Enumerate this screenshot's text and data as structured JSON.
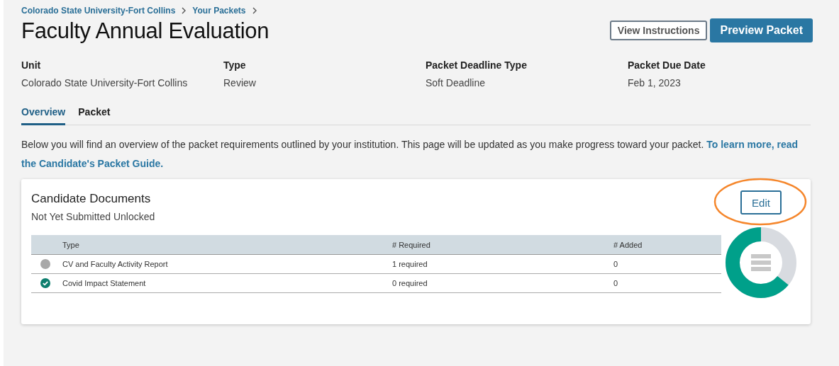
{
  "breadcrumbs": [
    "Colorado State University-Fort Collins",
    "Your Packets"
  ],
  "title": "Faculty Annual Evaluation",
  "actions": [
    {
      "label": "View Instructions",
      "kind": "secondary"
    },
    {
      "label": "Preview Packet",
      "kind": "primary"
    }
  ],
  "details": [
    {
      "label": "Unit",
      "value": "Colorado State University-Fort Collins"
    },
    {
      "label": "Type",
      "value": "Review"
    },
    {
      "label": "Packet Deadline Type",
      "value": "Soft Deadline"
    },
    {
      "label": "Packet Due Date",
      "value": "Feb 1, 2023"
    }
  ],
  "tabs": [
    {
      "label": "Overview",
      "selected": true
    },
    {
      "label": "Packet",
      "selected": false
    }
  ],
  "intro": {
    "text": "Below you will find an overview of the packet requirements outlined by your institution. This page will be updated as you make progress toward your packet.",
    "link_lines": [
      "To learn more, read",
      "the Candidate's Packet Guide."
    ]
  },
  "card": {
    "title": "Candidate Documents",
    "status": "Not Yet Submitted Unlocked",
    "edit_button": {
      "label": "Edit",
      "circled": true
    },
    "progress": {
      "level": 0.64
    },
    "table": {
      "columns": [
        "Type",
        "# Required",
        "# Added"
      ],
      "rows": [
        {
          "complete": false,
          "cells": [
            "CV and Faculty Activity Report",
            "1 required",
            "0"
          ]
        },
        {
          "complete": true,
          "cells": [
            "Covid Impact Statement",
            "0 required",
            "0"
          ]
        }
      ]
    }
  }
}
